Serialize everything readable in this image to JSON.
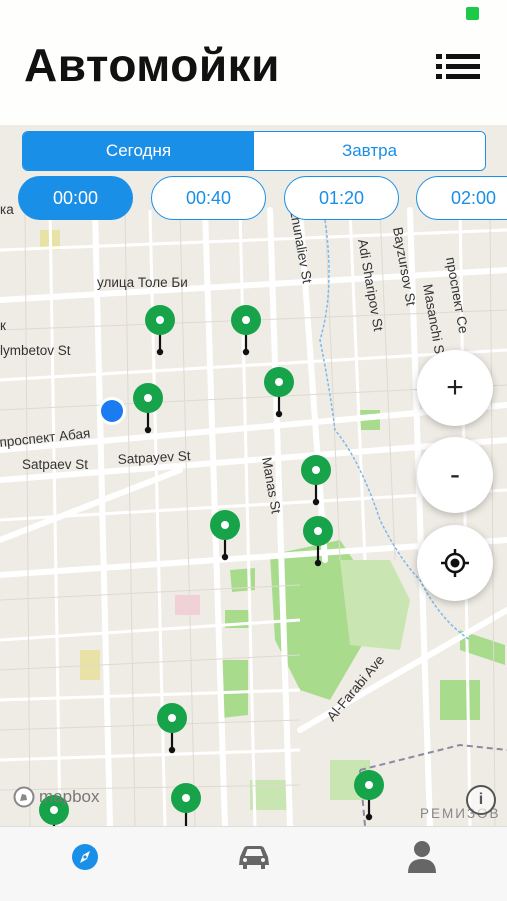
{
  "header": {
    "title": "Автомойки",
    "list_icon": "list-icon"
  },
  "day_selector": {
    "today": "Сегодня",
    "tomorrow": "Завтра",
    "selected": "today"
  },
  "time_slots": [
    "00:00",
    "00:40",
    "01:20",
    "02:00"
  ],
  "selected_slot": "00:00",
  "map": {
    "streets": [
      "улица Толе Би",
      "проспект Абая",
      "Satpaev St",
      "Satpayev St",
      "Zhunaliev St",
      "Adi Sharipov St",
      "Bayzursov St",
      "Masanchi St",
      "проспект Се",
      "Manas St",
      "Al-Farabi Ave",
      "lymbetov St",
      "РЕМИЗОВ",
      "ка",
      "к"
    ],
    "attribution": "mapbox",
    "colors": {
      "pin": "#16a34a",
      "user_location": "#1a7cf0",
      "park": "#a8dc8c",
      "road": "#ffffff",
      "accent": "#1a8fe8"
    }
  },
  "controls": {
    "zoom_in": "+",
    "zoom_out": "-",
    "locate_icon": "crosshair-icon",
    "info_icon": "i"
  },
  "tabbar": {
    "tabs": [
      {
        "icon": "compass-icon",
        "active": true
      },
      {
        "icon": "car-icon",
        "active": false
      },
      {
        "icon": "user-icon",
        "active": false
      }
    ]
  }
}
